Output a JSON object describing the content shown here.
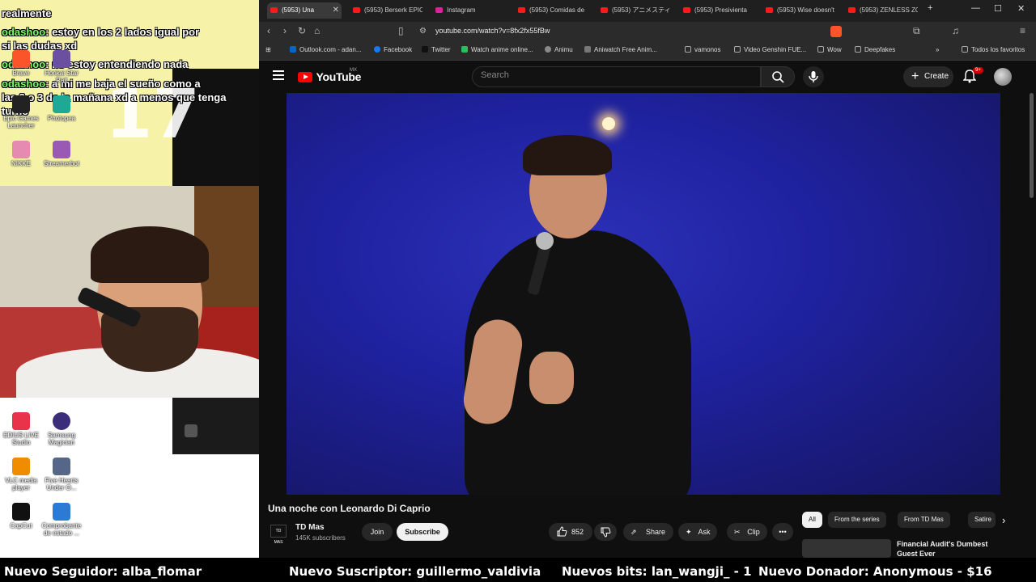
{
  "chat": {
    "lines": [
      {
        "user": "",
        "text": "realmente"
      },
      {
        "user": "odashoo",
        "text": ": estoy en los 2 lados igual por"
      },
      {
        "user": "",
        "text": "si las dudas xd"
      },
      {
        "user": "odashoo",
        "text": ": no estoy entendiendo nada"
      },
      {
        "user": "odashoo",
        "text": ": a mi me baja el sueño como a"
      },
      {
        "user": "",
        "text": "las 2 o 3 de la mañana xd a menos que tenga"
      },
      {
        "user": "",
        "text": "turno"
      }
    ],
    "big_number": "17"
  },
  "desktop_icons": [
    {
      "label": "Brave",
      "color": "#fb542b"
    },
    {
      "label": "Honkai Star Rail",
      "color": "#6b4fa0"
    },
    {
      "label": "Epic Games Launcher",
      "color": "#222222"
    },
    {
      "label": "Photopea",
      "color": "#1ea896"
    },
    {
      "label": "NIKKE",
      "color": "#e58ab0"
    },
    {
      "label": "Streamerbot",
      "color": "#9b59b6"
    },
    {
      "label": "EDIUS LIVE Studio",
      "color": "#e8334a"
    },
    {
      "label": "Samsung Magician",
      "color": "#3b2d7a"
    },
    {
      "label": "VLC media player",
      "color": "#f08c00"
    },
    {
      "label": "Five Hearts Under O...",
      "color": "#556688"
    },
    {
      "label": "CapCut",
      "color": "#111111"
    },
    {
      "label": "Comprobante de estado ...",
      "color": "#2b7bd6"
    }
  ],
  "browser": {
    "tabs": [
      {
        "label": "(5953) Una",
        "active": true
      },
      {
        "label": "(5953) Berserk EPIC",
        "active": false
      },
      {
        "label": "Instagram",
        "active": false
      },
      {
        "label": "(5953) Comidas de",
        "active": false
      },
      {
        "label": "(5953) アニメスティ",
        "active": false
      },
      {
        "label": "(5953) Presivienta",
        "active": false
      },
      {
        "label": "(5953) Wise doesn't",
        "active": false
      },
      {
        "label": "(5953) ZENLESS ZO",
        "active": false
      }
    ],
    "url": "youtube.com/watch?v=8fx2fx55fBw",
    "bookmarks": [
      {
        "label": "Outlook.com - adan...",
        "color": "#0a64c8"
      },
      {
        "label": "Facebook",
        "color": "#1877f2"
      },
      {
        "label": "Twitter",
        "color": "#111111"
      },
      {
        "label": "Watch anime online...",
        "color": "#2bbd5b"
      },
      {
        "label": "Animu",
        "color": "#888888"
      },
      {
        "label": "Aniwatch Free Anim...",
        "color": "#777777"
      },
      {
        "label": "vamonos",
        "color": "#aaaaaa"
      },
      {
        "label": "Video Genshin FUE...",
        "color": "#aaaaaa"
      },
      {
        "label": "Wow",
        "color": "#aaaaaa"
      },
      {
        "label": "Deepfakes",
        "color": "#aaaaaa"
      }
    ],
    "all_bookmarks": "Todos los favoritos"
  },
  "youtube": {
    "logo_text": "YouTube",
    "region": "MX",
    "search_placeholder": "Search",
    "create_label": "Create",
    "notifications": "9+",
    "video_title": "Una noche con Leonardo Di Caprio",
    "channel_name": "TD Mas",
    "channel_logo": "TD MAS",
    "subscribers": "145K subscribers",
    "join_label": "Join",
    "subscribe_label": "Subscribe",
    "likes": "852",
    "share_label": "Share",
    "ask_label": "Ask",
    "clip_label": "Clip",
    "chips": [
      "All",
      "From the series",
      "From TD Mas",
      "Satire"
    ],
    "rec_title": "Financial Audit's Dumbest Guest Ever"
  },
  "ticker": {
    "follower": "Nuevo Seguidor: alba_flomar",
    "subscriber": "Nuevo Suscriptor: guillermo_valdivia",
    "bits": "Nuevos bits: lan_wangji_ - 1",
    "donor": "Nuevo Donador: Anonymous - $16"
  }
}
